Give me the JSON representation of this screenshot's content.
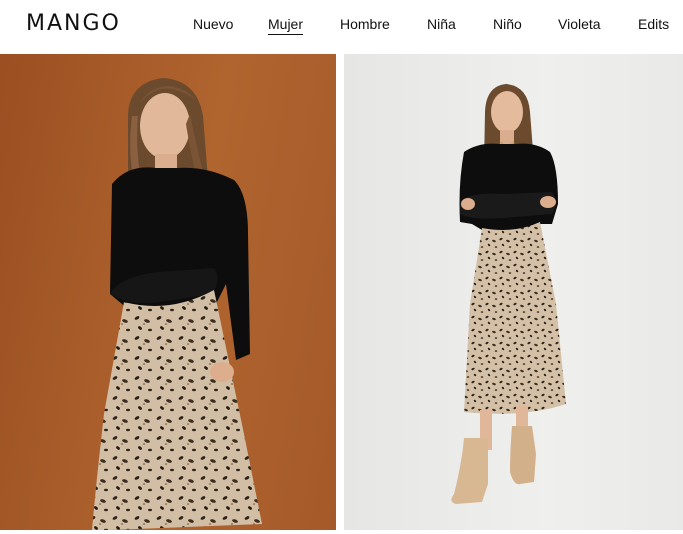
{
  "brand": {
    "logo_text": "MANGO"
  },
  "nav": {
    "items": [
      {
        "label": "Nuevo",
        "active": false
      },
      {
        "label": "Mujer",
        "active": true
      },
      {
        "label": "Hombre",
        "active": false
      },
      {
        "label": "Niña",
        "active": false
      },
      {
        "label": "Niño",
        "active": false
      },
      {
        "label": "Violeta",
        "active": false
      },
      {
        "label": "Edits",
        "active": false
      }
    ]
  },
  "colors": {
    "left_background": "#a85a2a",
    "right_background": "#ececea",
    "sweater": "#0d0d0d",
    "skirt": "#cbb59a",
    "boots": "#d8b893"
  }
}
